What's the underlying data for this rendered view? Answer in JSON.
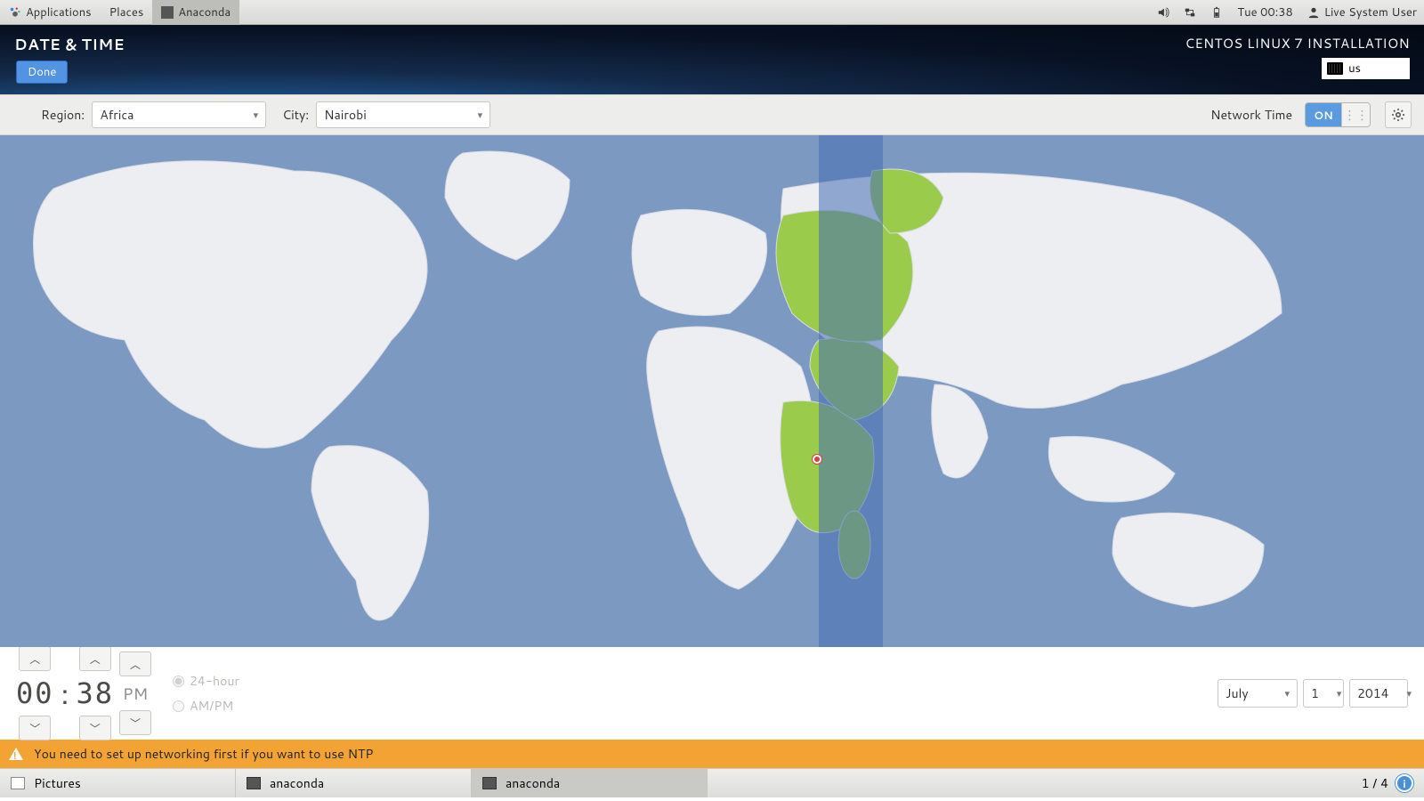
{
  "gnome": {
    "applications": "Applications",
    "places": "Places",
    "active_app": "Anaconda",
    "clock": "Tue 00:38",
    "user": "Live System User"
  },
  "header": {
    "title": "DATE & TIME",
    "done": "Done",
    "install_title": "CENTOS LINUX 7 INSTALLATION",
    "kb_layout": "us"
  },
  "region_bar": {
    "region_label": "Region:",
    "region_value": "Africa",
    "city_label": "City:",
    "city_value": "Nairobi",
    "network_time_label": "Network Time",
    "network_time_state": "ON"
  },
  "time": {
    "hours": "00",
    "minutes": "38",
    "ampm": "PM",
    "fmt24_label": "24-hour",
    "ampm_label": "AM/PM",
    "fmt_selected": "24"
  },
  "date": {
    "month": "July",
    "day": "1",
    "year": "2014"
  },
  "warning": "You need to set up networking first if you want to use NTP",
  "taskbar": {
    "items": [
      {
        "label": "Pictures",
        "active": false,
        "dark": false
      },
      {
        "label": "anaconda",
        "active": false,
        "dark": true
      },
      {
        "label": "anaconda",
        "active": true,
        "dark": true
      }
    ],
    "workspace": "1 / 4"
  }
}
